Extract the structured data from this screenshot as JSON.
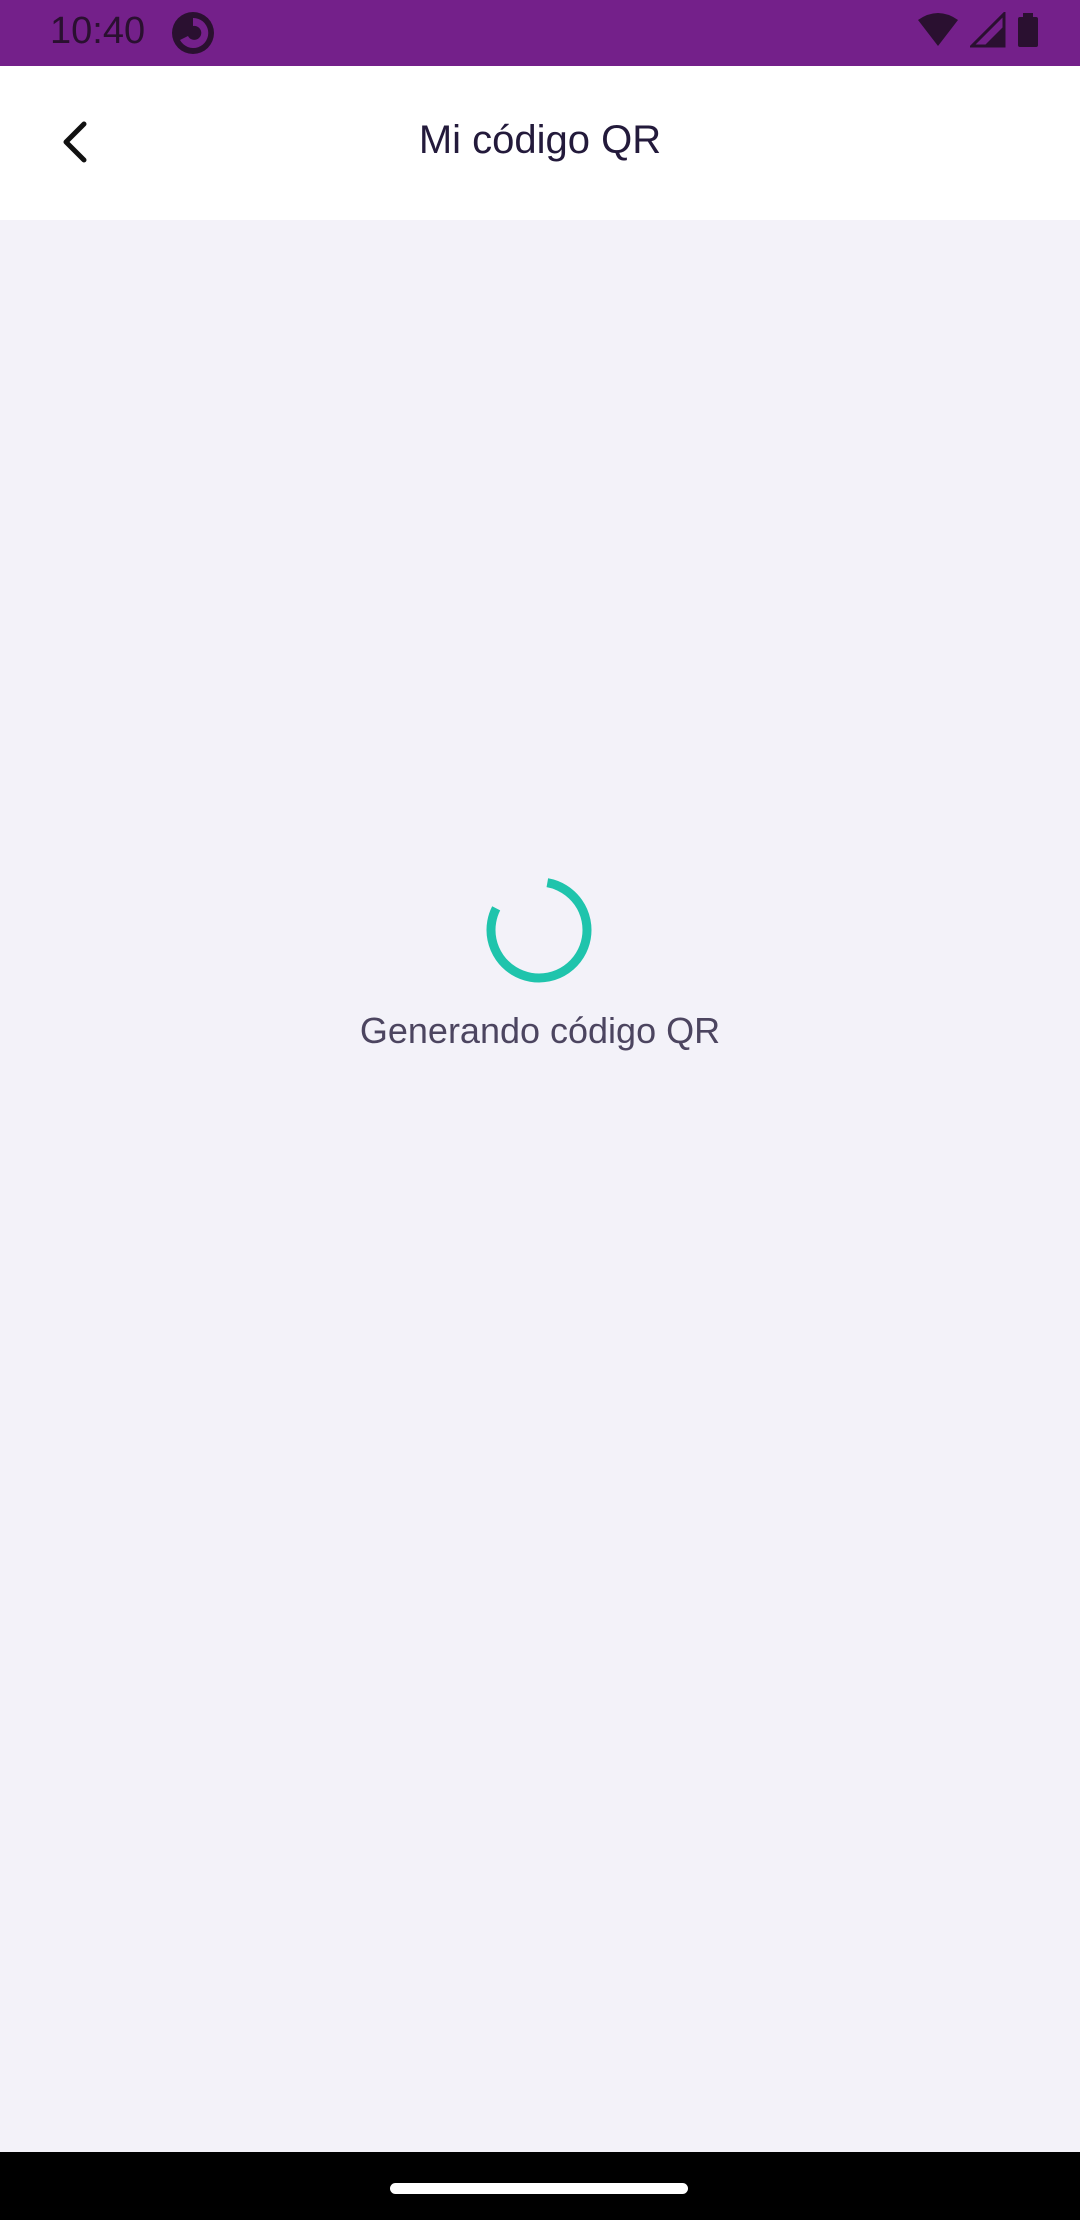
{
  "status_bar": {
    "time": "10:40",
    "background_color": "#74208a",
    "icons": [
      "app-notification-icon",
      "wifi-icon",
      "signal-icon",
      "battery-icon"
    ]
  },
  "header": {
    "title": "Mi código QR",
    "back_icon": "chevron-left-icon"
  },
  "main": {
    "loading_text": "Generando código QR",
    "spinner_color": "#1fc4ac",
    "background_color": "#f3f2f9"
  }
}
